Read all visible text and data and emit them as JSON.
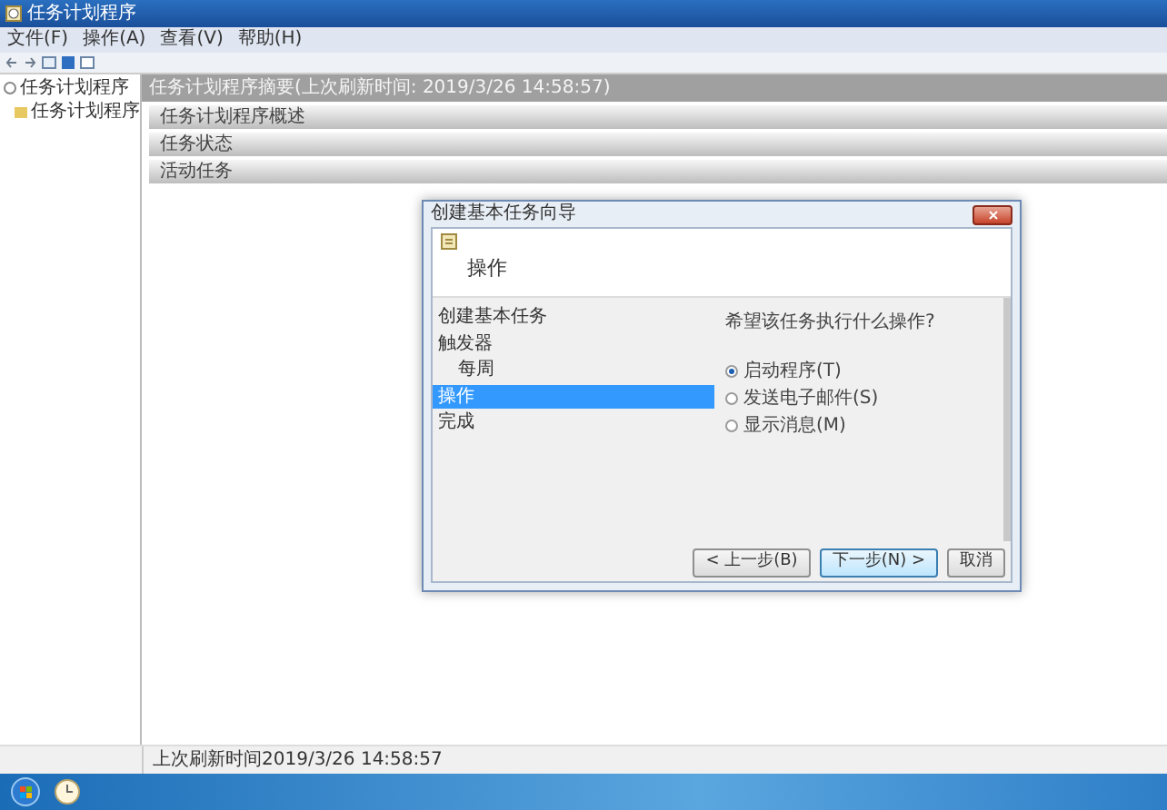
{
  "window": {
    "title": "任务计划程序"
  },
  "menu": [
    {
      "label": "文件(F)"
    },
    {
      "label": "操作(A)"
    },
    {
      "label": "查看(V)"
    },
    {
      "label": "帮助(H)"
    }
  ],
  "tree": [
    {
      "label": "任务计划程序",
      "children": [
        {
          "label": "任务计划程序"
        }
      ]
    }
  ],
  "summary": {
    "header": "任务计划程序摘要(上次刷新时间: 2019/3/26 14:58:57)",
    "sections": [
      {
        "label": "任务计划程序概述"
      },
      {
        "label": "任务状态"
      },
      {
        "label": "活动任务"
      }
    ]
  },
  "status_bar": "上次刷新时间2019/3/26 14:58:57",
  "dialog": {
    "title": "创建基本任务向导",
    "heading": "操作",
    "steps": [
      {
        "label": "创建基本任务",
        "selected": false
      },
      {
        "label": "触发器",
        "selected": false,
        "children": [
          {
            "label": "每周",
            "selected": false
          }
        ]
      },
      {
        "label": "操作",
        "selected": true
      },
      {
        "label": "完成",
        "selected": false
      }
    ],
    "question": "希望该任务执行什么操作?",
    "options": [
      {
        "label": "启动程序(T)",
        "selected": true
      },
      {
        "label": "发送电子邮件(S)",
        "selected": false
      },
      {
        "label": "显示消息(M)",
        "selected": false
      }
    ],
    "buttons": [
      {
        "label": "< 上一步(B)",
        "default": false
      },
      {
        "label": "下一步(N) >",
        "default": true
      },
      {
        "label": "取消",
        "default": false
      }
    ]
  }
}
